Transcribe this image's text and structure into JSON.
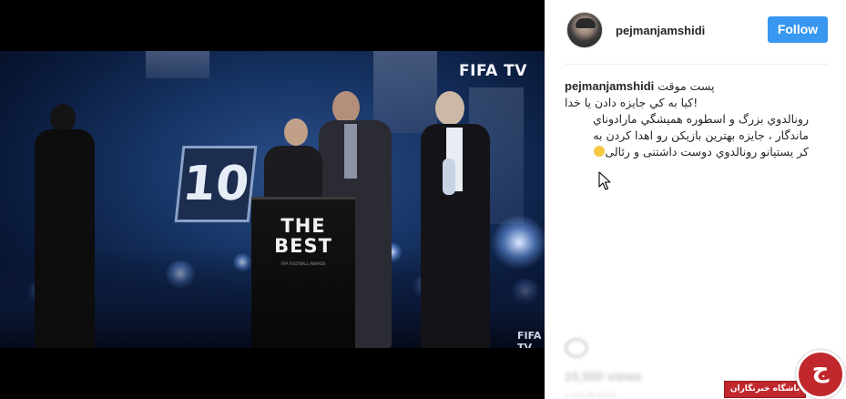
{
  "video": {
    "channel_logo": "FIFA TV",
    "channel_logo_small": "FIFA TV",
    "backdrop_number": "10",
    "podium_logo_line1": "THE",
    "podium_logo_line2": "BEST",
    "podium_subtitle": "FIFA FOOTBALL AWARDS"
  },
  "post": {
    "username": "pejmanjamshidi",
    "follow_label": "Follow",
    "caption": {
      "user": "pejmanjamshidi",
      "line1_text": "پست موقت",
      "line2": "!کيا به کي جايزه دادن يا خدا",
      "line3": "رونالدوي بزرگ و اسطوره هميشگي مارادوناي",
      "line4": "ماندگار ، جايزه بهترين بازيکن رو اهدا کردن به",
      "line5": "کر يستيانو رونالدوي دوست داشتنى و رئالى"
    },
    "blurred": {
      "views": "10,500 views",
      "date": "1 HOUR AGO"
    }
  },
  "watermark": {
    "glyph": "ج",
    "label": "باشگاه خبرنگاران"
  },
  "colors": {
    "follow_button": "#3897f0",
    "watermark_red": "#c0282d",
    "text_primary": "#262626"
  },
  "icons": {
    "cursor": "arrow-cursor-icon",
    "like": "heart-icon",
    "emoji": "smiling-face-icon"
  }
}
